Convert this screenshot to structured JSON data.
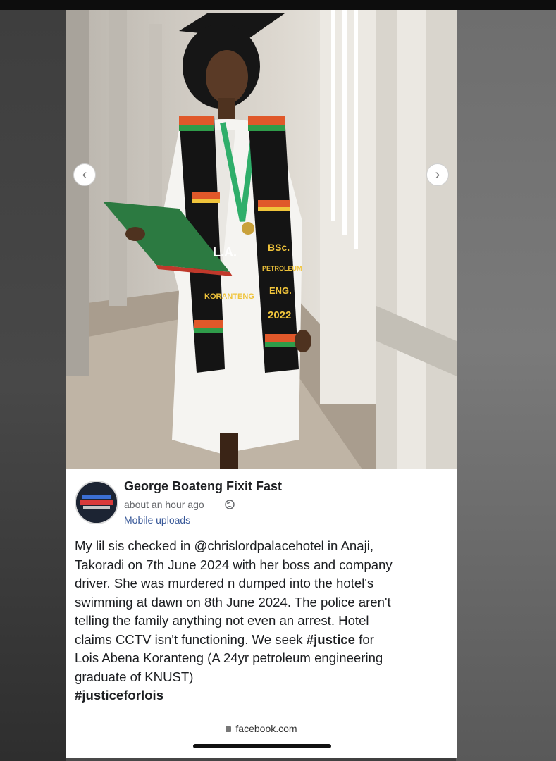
{
  "post": {
    "author": "George Boateng Fixit Fast",
    "timestamp": "about an hour ago",
    "privacy_icon": "globe-icon",
    "album": "Mobile uploads",
    "lines": [
      "My lil sis checked in @chrislordpalacehotel in Anaji,",
      "Takoradi on 7th June 2024 with her boss and company",
      "driver. She was murdered n dumped into the hotel's",
      "swimming at dawn on 8th June 2024. The police aren't",
      "telling the family anything not even an arrest. Hotel",
      "claims CCTV isn't functioning. We seek",
      "#justice",
      "for",
      "Lois Abena Koranteng (A 24yr petroleum engineering",
      "graduate of KNUST)",
      "#justiceforlois"
    ]
  },
  "photo": {
    "stole_left": "L.A.",
    "stole_name": "KORANTENG",
    "stole_right_1": "BSc.",
    "stole_right_2": "PETROLEUM",
    "stole_right_3": "ENG.",
    "stole_year": "2022",
    "prev_icon": "chevron-left-icon",
    "next_icon": "chevron-right-icon"
  },
  "browser": {
    "url": "facebook.com",
    "lock_icon": "lock-icon"
  },
  "colors": {
    "link": "#385898",
    "text": "#1c1e21",
    "muted": "#65676b"
  }
}
